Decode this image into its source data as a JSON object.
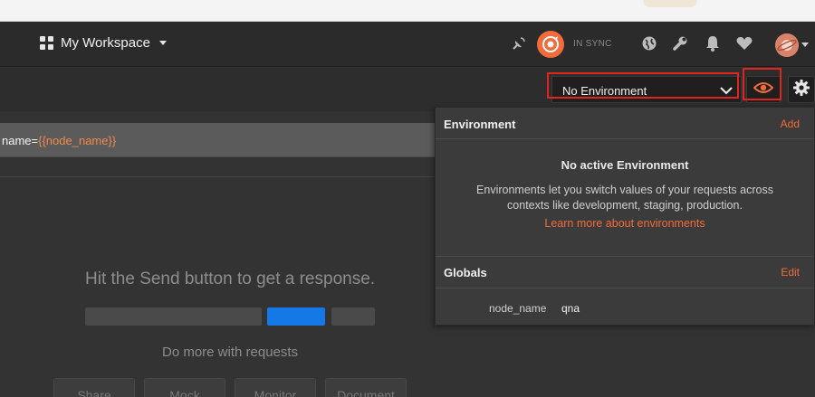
{
  "header": {
    "workspace_label": "My Workspace",
    "sync_label": "IN SYNC"
  },
  "environment": {
    "selected": "No Environment"
  },
  "request": {
    "url_prefix": "name=",
    "url_variable": "{{node_name}}"
  },
  "response": {
    "hint": "Hit the Send button to get a response.",
    "do_more": "Do more with requests",
    "actions": [
      "Share",
      "Mock",
      "Monitor",
      "Document"
    ]
  },
  "popover": {
    "env_title": "Environment",
    "env_add": "Add",
    "no_active": "No active Environment",
    "description": "Environments let you switch values of your requests across contexts like development, staging, production.",
    "learn_more": "Learn more about environments",
    "globals_title": "Globals",
    "globals_edit": "Edit",
    "globals": [
      {
        "key": "node_name",
        "value": "qna"
      }
    ]
  },
  "colors": {
    "accent": "#f26b3a",
    "highlight": "#e0241f",
    "primary_button": "#1479e6"
  },
  "icons": [
    "grid-icon",
    "satellite-icon",
    "sync-icon",
    "globe-icon",
    "wrench-icon",
    "bell-icon",
    "heart-icon",
    "avatar",
    "chevron-down-icon",
    "eye-icon",
    "gear-icon"
  ]
}
